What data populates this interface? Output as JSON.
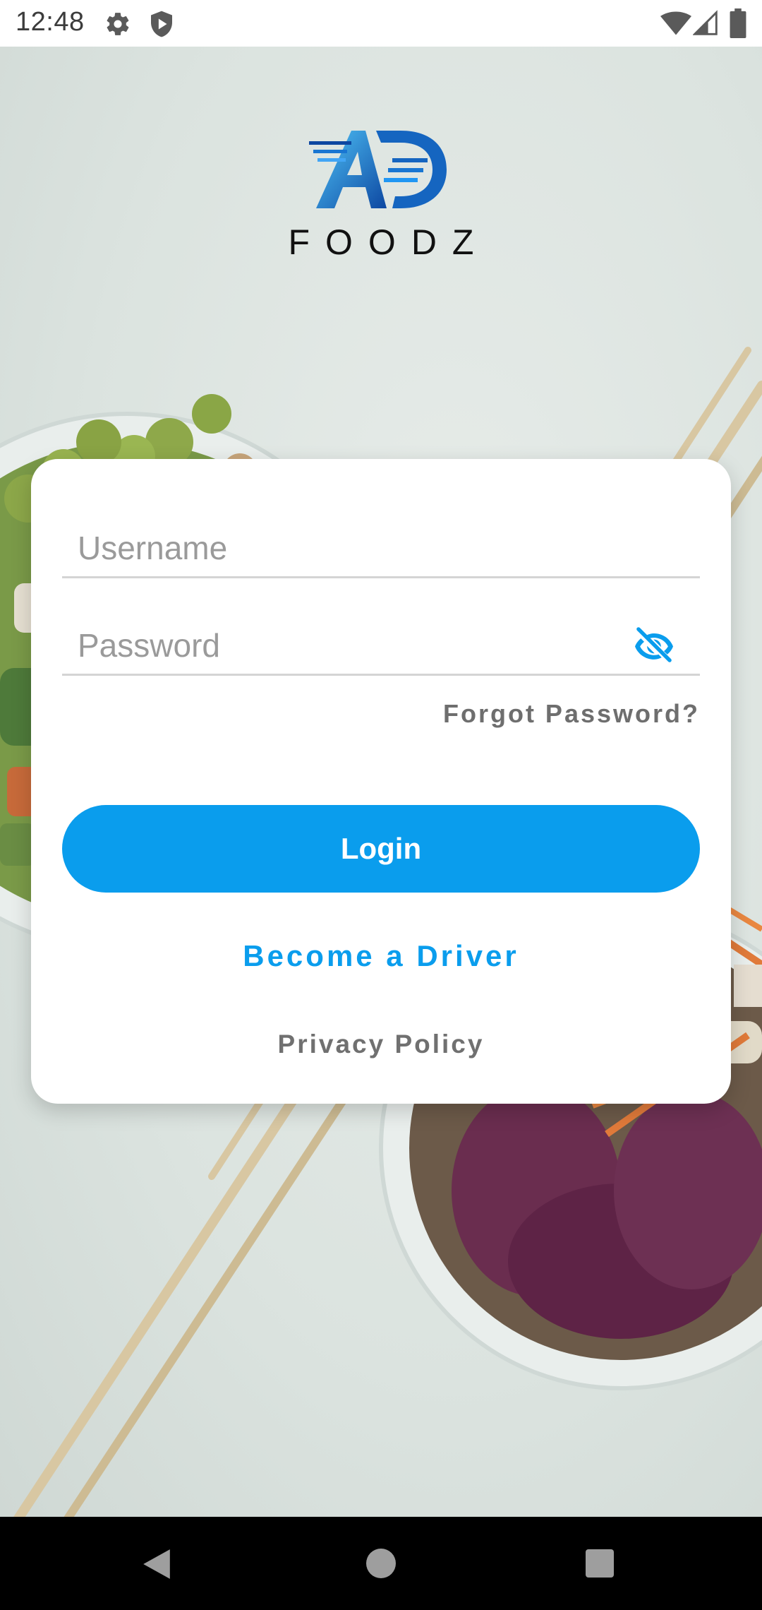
{
  "status_bar": {
    "time": "12:48",
    "icons": [
      "gear-icon",
      "shield-icon",
      "wifi-icon",
      "signal-icon",
      "battery-icon"
    ]
  },
  "brand": {
    "logo_icon": "ad-logo-icon",
    "name": "FOODZ",
    "logo_colors": [
      "#4fc3f7",
      "#0d47a1"
    ]
  },
  "login_form": {
    "username": {
      "value": "",
      "placeholder": "Username"
    },
    "password": {
      "value": "",
      "placeholder": "Password",
      "toggle_icon": "eye-off-icon"
    },
    "forgot_password_label": "Forgot Password?",
    "login_label": "Login",
    "become_driver_label": "Become a Driver",
    "privacy_policy_label": "Privacy Policy"
  },
  "nav_bar": {
    "icons": [
      "back-icon",
      "home-icon",
      "recents-icon"
    ]
  },
  "colors": {
    "accent": "#0a9ded",
    "card_background": "#ffffff",
    "muted_text": "#707070"
  }
}
